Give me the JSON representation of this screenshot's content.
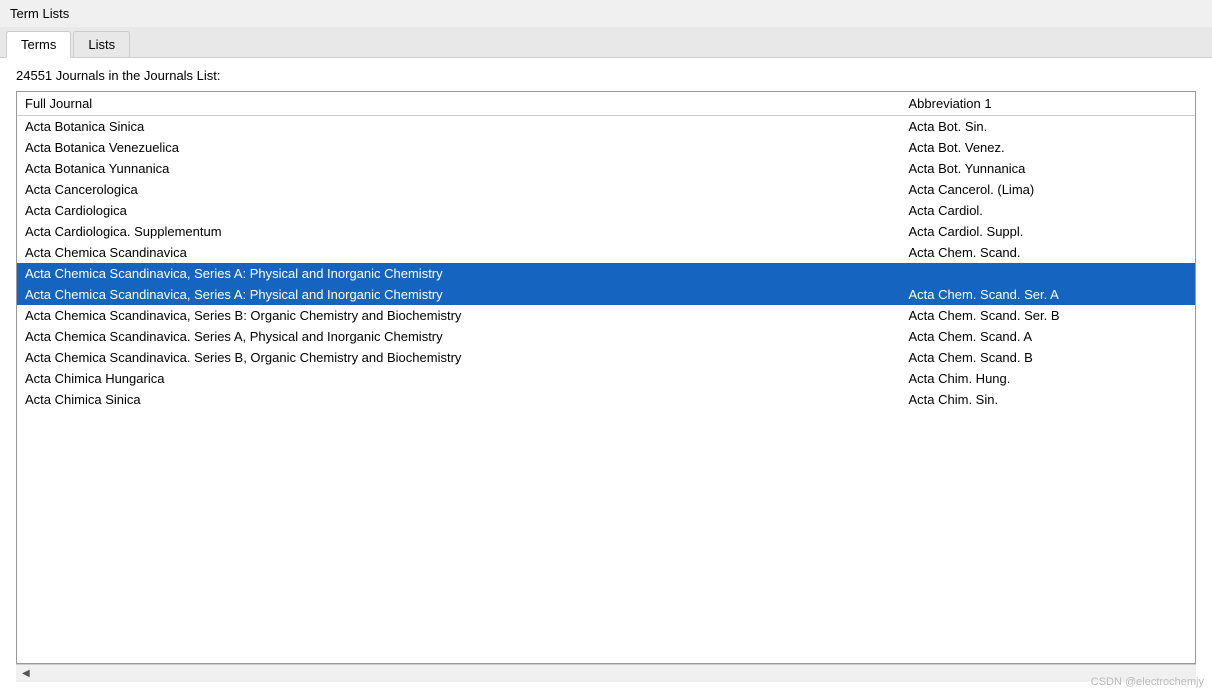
{
  "title": "Term Lists",
  "tabs": [
    {
      "id": "terms",
      "label": "Terms",
      "active": true
    },
    {
      "id": "lists",
      "label": "Lists",
      "active": false
    }
  ],
  "journal_count_text": "24551 Journals in the Journals List:",
  "table": {
    "col_full_header": "Full Journal",
    "col_abbr_header": "Abbreviation 1",
    "rows": [
      {
        "full": "Acta Botanica Sinica",
        "abbr": "Acta Bot. Sin.",
        "selected": false
      },
      {
        "full": "Acta Botanica Venezuelica",
        "abbr": "Acta Bot. Venez.",
        "selected": false
      },
      {
        "full": "Acta Botanica Yunnanica",
        "abbr": "Acta Bot. Yunnanica",
        "selected": false
      },
      {
        "full": "Acta Cancerologica",
        "abbr": "Acta Cancerol. (Lima)",
        "selected": false
      },
      {
        "full": "Acta Cardiologica",
        "abbr": "Acta Cardiol.",
        "selected": false
      },
      {
        "full": "Acta Cardiologica. Supplementum",
        "abbr": "Acta Cardiol. Suppl.",
        "selected": false
      },
      {
        "full": "Acta Chemica Scandinavica",
        "abbr": "Acta Chem. Scand.",
        "selected": false
      },
      {
        "full": "Acta Chemica Scandinavica, Series A: Physical and Inorganic Chemistry",
        "abbr": "",
        "selected": true
      },
      {
        "full": "Acta Chemica Scandinavica, Series A: Physical and Inorganic Chemistry",
        "abbr": "Acta Chem. Scand. Ser. A",
        "selected": true
      },
      {
        "full": "Acta Chemica Scandinavica, Series B: Organic Chemistry and Biochemistry",
        "abbr": "Acta Chem. Scand. Ser. B",
        "selected": false
      },
      {
        "full": "Acta Chemica Scandinavica. Series A, Physical and Inorganic Chemistry",
        "abbr": "Acta Chem. Scand. A",
        "selected": false
      },
      {
        "full": "Acta Chemica Scandinavica. Series B, Organic Chemistry and Biochemistry",
        "abbr": "Acta Chem. Scand. B",
        "selected": false
      },
      {
        "full": "Acta Chimica Hungarica",
        "abbr": "Acta Chim. Hung.",
        "selected": false
      },
      {
        "full": "Acta Chimica Sinica",
        "abbr": "Acta Chim. Sin.",
        "selected": false
      }
    ]
  },
  "watermark": "CSDN @electrochemjy"
}
